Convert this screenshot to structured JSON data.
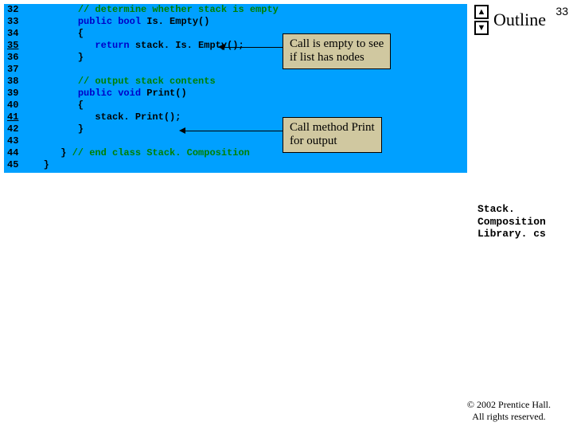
{
  "page_number": "33",
  "outline": {
    "label": "Outline",
    "up_glyph": "▲",
    "down_glyph": "▼"
  },
  "code": {
    "lines": [
      {
        "n": "32",
        "indent": "         ",
        "comment": "// determine whether stack is empty"
      },
      {
        "n": "33",
        "indent": "         ",
        "kw1": "public",
        "sp1": " ",
        "kw2": "bool",
        "rest": " Is. Empty()"
      },
      {
        "n": "34",
        "indent": "         ",
        "plain": "{"
      },
      {
        "n": "35",
        "indent": "            ",
        "kw1": "return",
        "rest": " stack. Is. Empty();",
        "underline_lineno": true
      },
      {
        "n": "36",
        "indent": "         ",
        "plain": "}"
      },
      {
        "n": "37",
        "indent": "",
        "plain": ""
      },
      {
        "n": "38",
        "indent": "         ",
        "comment": "// output stack contents"
      },
      {
        "n": "39",
        "indent": "         ",
        "kw1": "public",
        "sp1": " ",
        "kw2": "void",
        "rest": " Print()"
      },
      {
        "n": "40",
        "indent": "         ",
        "plain": "{"
      },
      {
        "n": "41",
        "indent": "            ",
        "plain": "stack. Print();",
        "underline_lineno": true
      },
      {
        "n": "42",
        "indent": "         ",
        "plain": "}"
      },
      {
        "n": "43",
        "indent": "",
        "plain": ""
      },
      {
        "n": "44",
        "indent": "      ",
        "plain": "} ",
        "comment": "// end class Stack. Composition"
      },
      {
        "n": "45",
        "indent": "   ",
        "plain": "}"
      }
    ]
  },
  "callouts": {
    "c1": {
      "l1": "Call is empty to see",
      "l2": "if list has nodes"
    },
    "c2": {
      "l1": "Call method Print",
      "l2": "for output"
    }
  },
  "file_label": {
    "l1": "Stack. Composition",
    "l2": "Library. cs"
  },
  "copyright": {
    "l1": "© 2002 Prentice Hall.",
    "l2": "All rights reserved."
  }
}
